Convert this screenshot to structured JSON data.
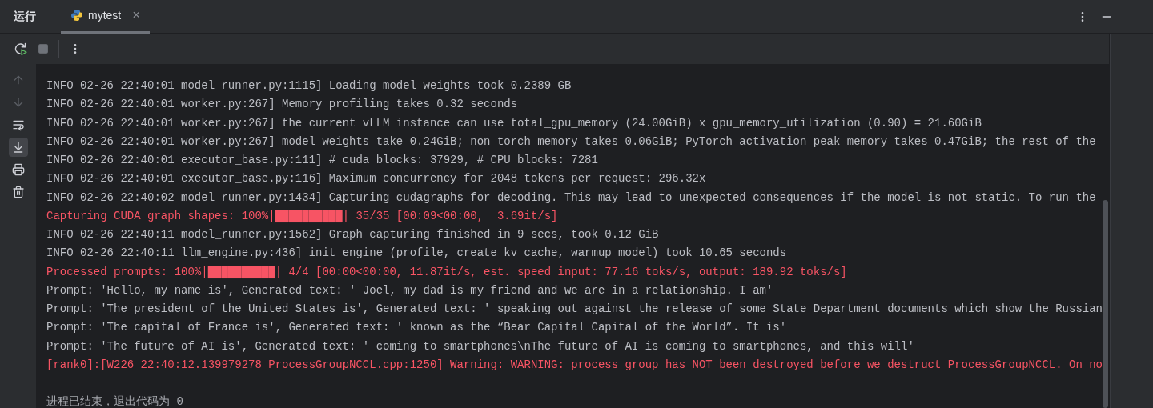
{
  "panel": {
    "title": "运行",
    "tabs": [
      {
        "label": "mytest",
        "selected": true,
        "close": "×"
      }
    ]
  },
  "toolbar": [
    {
      "kind": "rerun"
    },
    {
      "kind": "stop"
    },
    {
      "kind": "more"
    }
  ],
  "side_tools": [
    {
      "kind": "up",
      "disabled": true,
      "selected": false
    },
    {
      "kind": "down",
      "disabled": true,
      "selected": false
    },
    {
      "kind": "wrap",
      "disabled": false,
      "selected": false
    },
    {
      "kind": "scroll-end",
      "disabled": false,
      "selected": true
    },
    {
      "kind": "print",
      "disabled": false,
      "selected": false
    },
    {
      "kind": "trash",
      "disabled": false,
      "selected": false
    }
  ],
  "console": [
    {
      "kind": "info",
      "text": "INFO 02-26 22:40:01 model_runner.py:1115] Loading model weights took 0.2389 GB"
    },
    {
      "kind": "info",
      "text": "INFO 02-26 22:40:01 worker.py:267] Memory profiling takes 0.32 seconds"
    },
    {
      "kind": "info",
      "text": "INFO 02-26 22:40:01 worker.py:267] the current vLLM instance can use total_gpu_memory (24.00GiB) x gpu_memory_utilization (0.90) = 21.60GiB"
    },
    {
      "kind": "info",
      "text": "INFO 02-26 22:40:01 worker.py:267] model weights take 0.24GiB; non_torch_memory takes 0.06GiB; PyTorch activation peak memory takes 0.47GiB; the rest of the"
    },
    {
      "kind": "info",
      "text": "INFO 02-26 22:40:01 executor_base.py:111] # cuda blocks: 37929, # CPU blocks: 7281"
    },
    {
      "kind": "info",
      "text": "INFO 02-26 22:40:01 executor_base.py:116] Maximum concurrency for 2048 tokens per request: 296.32x"
    },
    {
      "kind": "info",
      "text": "INFO 02-26 22:40:02 model_runner.py:1434] Capturing cudagraphs for decoding. This may lead to unexpected consequences if the model is not static. To run the"
    },
    {
      "kind": "error",
      "text": "Capturing CUDA graph shapes: 100%|██████████| 35/35 [00:09<00:00,  3.69it/s]"
    },
    {
      "kind": "info",
      "text": "INFO 02-26 22:40:11 model_runner.py:1562] Graph capturing finished in 9 secs, took 0.12 GiB"
    },
    {
      "kind": "info",
      "text": "INFO 02-26 22:40:11 llm_engine.py:436] init engine (profile, create kv cache, warmup model) took 10.65 seconds"
    },
    {
      "kind": "error",
      "text": "Processed prompts: 100%|██████████| 4/4 [00:00<00:00, 11.87it/s, est. speed input: 77.16 toks/s, output: 189.92 toks/s]"
    },
    {
      "kind": "info",
      "text": "Prompt: 'Hello, my name is', Generated text: ' Joel, my dad is my friend and we are in a relationship. I am'"
    },
    {
      "kind": "info",
      "text": "Prompt: 'The president of the United States is', Generated text: ' speaking out against the release of some State Department documents which show the Russian"
    },
    {
      "kind": "info",
      "text": "Prompt: 'The capital of France is', Generated text: ' known as the “Bear Capital Capital of the World”. It is'"
    },
    {
      "kind": "info",
      "text": "Prompt: 'The future of AI is', Generated text: ' coming to smartphones\\nThe future of AI is coming to smartphones, and this will'"
    },
    {
      "kind": "error",
      "text": "[rank0]:[W226 22:40:12.139979278 ProcessGroupNCCL.cpp:1250] Warning: WARNING: process group has NOT been destroyed before we destruct ProcessGroupNCCL. On no"
    },
    {
      "kind": "exit",
      "text": "进程已结束，退出代码为 0"
    }
  ]
}
